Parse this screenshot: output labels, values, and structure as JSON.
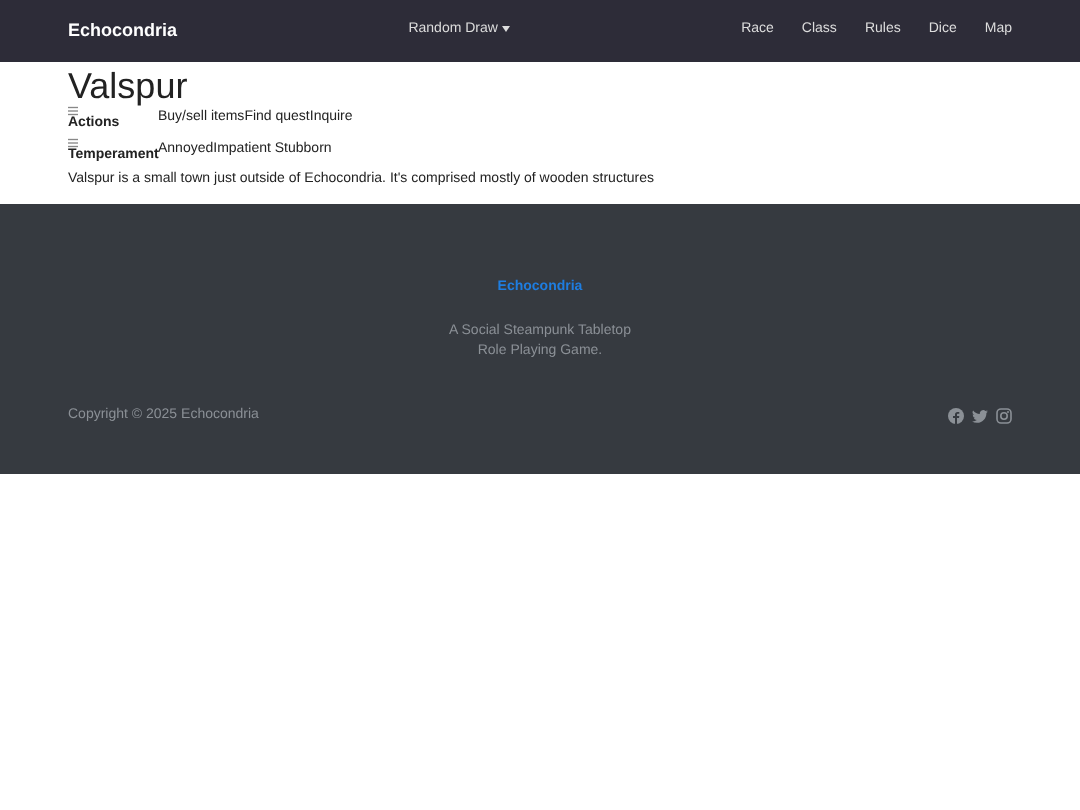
{
  "navbar": {
    "brand": "Echocondria",
    "dropdown": "Random Draw",
    "links": [
      "Race",
      "Class",
      "Rules",
      "Dice",
      "Map"
    ]
  },
  "place": {
    "title": "Valspur",
    "groups": [
      {
        "label": "Actions",
        "items": [
          "Buy/sell items",
          "Find quest",
          "Inquire"
        ]
      },
      {
        "label": "Temperament",
        "items": [
          "Annoyed",
          "Impatient Stubborn"
        ]
      }
    ],
    "description": "Valspur is a small town just outside of Echocondria. It's comprised mostly of wooden structures"
  },
  "footer": {
    "brand": "Echocondria",
    "tagline": "A Social Steampunk Tabletop Role Playing Game.",
    "copyright": "Copyright © 2025 Echocondria"
  }
}
